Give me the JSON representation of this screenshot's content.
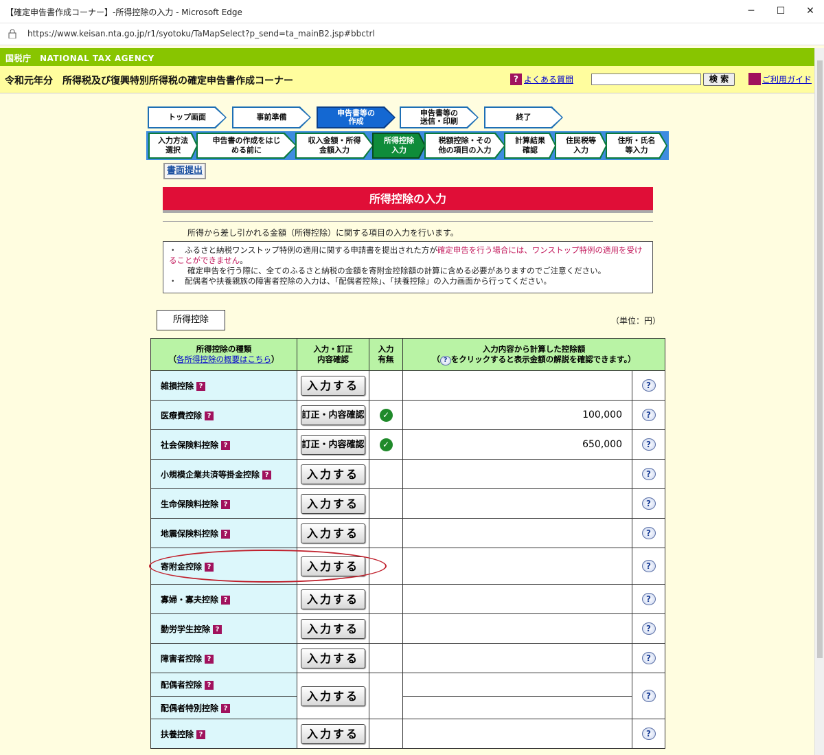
{
  "window": {
    "title": "【確定申告書作成コーナー】-所得控除の入力 - Microsoft Edge",
    "url": "https://www.keisan.nta.go.jp/r1/syotoku/TaMapSelect?p_send=ta_mainB2.jsp#bbctrl",
    "controls": [
      "─",
      "☐",
      "✕"
    ]
  },
  "header": {
    "agency": "国税庁　NATIONAL TAX AGENCY",
    "title": "令和元年分　所得税及び復興特別所得税の確定申告書作成コーナー",
    "faq": "よくある質問",
    "search_btn": "検 索",
    "guide": "ご利用ガイド"
  },
  "steps": [
    "トップ画面",
    "事前準備",
    "申告書等の\n作成",
    "申告書等の\n送信・印刷",
    "終了"
  ],
  "substeps": [
    "入力方法\n選択",
    "申告書の作成をはじ\nめる前に",
    "収入金額・所得\n金額入力",
    "所得控除\n入力",
    "税額控除・その\n他の項目の入力",
    "計算結果\n確認",
    "住民税等\n入力",
    "住所・氏名\n等入力"
  ],
  "submit_label": "書面提出",
  "page_title": "所得控除の入力",
  "intro": "所得から差し引かれる金額（所得控除）に関する項目の入力を行います。",
  "notes": {
    "n1a": "ふるさと納税ワンストップ特例の適用に関する申請書を提出された方が",
    "n1red": "確定申告を行う場合には、ワンストップ特例の適用を受けることができません",
    "n1b": "。",
    "n2": "確定申告を行う際に、全てのふるさと納税の金額を寄附金控除額の計算に含める必要がありますのでご注意ください。",
    "n3": "配偶者や扶養親族の障害者控除の入力は、「配偶者控除」、「扶養控除」の入力画面から行ってください。"
  },
  "tab_label": "所得控除",
  "unit": "（単位：円）",
  "table": {
    "h1": "所得控除の種類",
    "h1link": "各所得控除の概要はこちら",
    "h2": "入力・訂正\n内容確認",
    "h3": "入力\n有無",
    "h4a": "入力内容から計算した控除額",
    "h4b": "をクリックすると表示金額の解説を確認できます。）",
    "rows": [
      {
        "name": "雑損控除",
        "btn": "入力する",
        "done": false,
        "amount": ""
      },
      {
        "name": "医療費控除",
        "btn": "訂正・内容確認",
        "done": true,
        "amount": "100,000"
      },
      {
        "name": "社会保険料控除",
        "btn": "訂正・内容確認",
        "done": true,
        "amount": "650,000"
      },
      {
        "name": "小規模企業共済等掛金控除",
        "btn": "入力する",
        "done": false,
        "amount": ""
      },
      {
        "name": "生命保険料控除",
        "btn": "入力する",
        "done": false,
        "amount": ""
      },
      {
        "name": "地震保険料控除",
        "btn": "入力する",
        "done": false,
        "amount": ""
      },
      {
        "name": "寄附金控除",
        "btn": "入力する",
        "done": false,
        "amount": ""
      },
      {
        "name": "寡婦・寡夫控除",
        "btn": "入力する",
        "done": false,
        "amount": ""
      },
      {
        "name": "勤労学生控除",
        "btn": "入力する",
        "done": false,
        "amount": ""
      },
      {
        "name": "障害者控除",
        "btn": "入力する",
        "done": false,
        "amount": ""
      }
    ],
    "spouse": {
      "name1": "配偶者控除",
      "name2": "配偶者特別控除",
      "btn": "入力する"
    },
    "last": {
      "name": "扶養控除",
      "btn": "入力する"
    }
  }
}
